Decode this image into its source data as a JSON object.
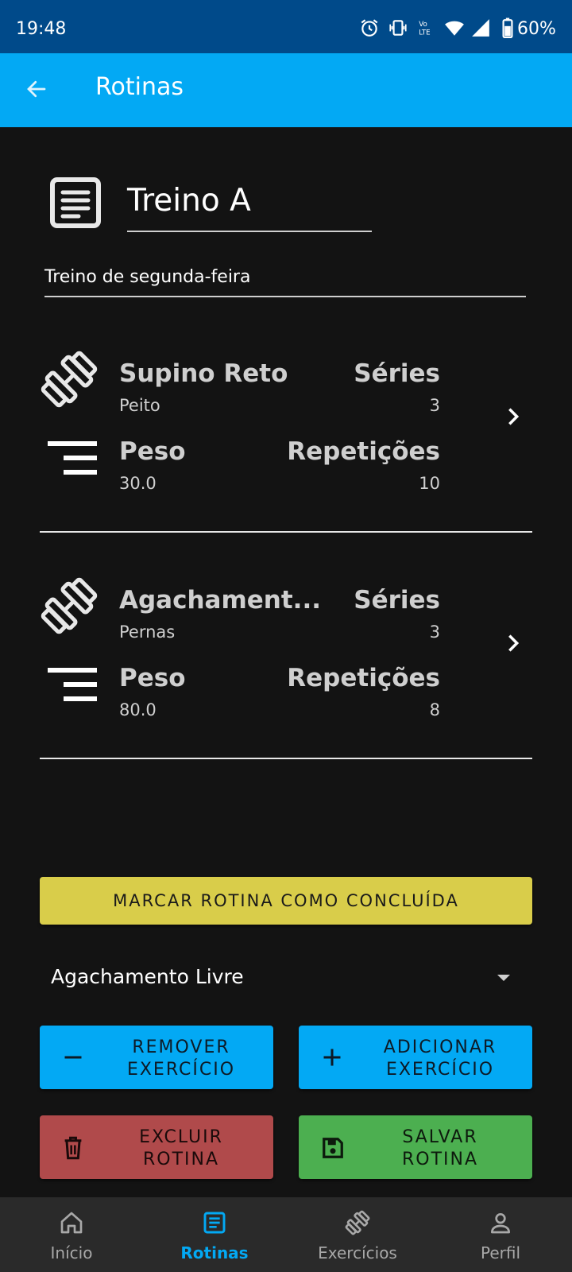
{
  "status_bar": {
    "time": "19:48",
    "battery": "60%",
    "icons": [
      "alarm-icon",
      "vibrate-icon",
      "volte-icon",
      "wifi-icon",
      "signal-icon",
      "battery-icon"
    ]
  },
  "app_bar": {
    "title": "Rotinas",
    "back_icon": "arrow-back-icon"
  },
  "routine": {
    "name": "Treino A",
    "description": "Treino de segunda-feira"
  },
  "labels": {
    "series": "Séries",
    "weight": "Peso",
    "reps": "Repetições"
  },
  "exercises": [
    {
      "name": "Supino Reto",
      "group": "Peito",
      "series": "3",
      "weight": "30.0",
      "reps": "10"
    },
    {
      "name": "Agachament...",
      "group": "Pernas",
      "series": "3",
      "weight": "80.0",
      "reps": "8"
    }
  ],
  "actions": {
    "complete": "MARCAR ROTINA COMO CONCLUÍDA",
    "selected_exercise": "Agachamento Livre",
    "remove_line1": "REMOVER",
    "remove_line2": "EXERCÍCIO",
    "add_line1": "ADICIONAR",
    "add_line2": "EXERCÍCIO",
    "delete_line1": "EXCLUIR",
    "delete_line2": "ROTINA",
    "save_line1": "SALVAR",
    "save_line2": "ROTINA"
  },
  "bottom_nav": [
    {
      "label": "Início",
      "icon": "home-icon",
      "active": false
    },
    {
      "label": "Rotinas",
      "icon": "list-icon",
      "active": true
    },
    {
      "label": "Exercícios",
      "icon": "dumbbell-icon",
      "active": false
    },
    {
      "label": "Perfil",
      "icon": "person-icon",
      "active": false
    }
  ],
  "colors": {
    "status_bar": "#004a8a",
    "app_bar": "#03a9f4",
    "background": "#131313",
    "complete_button": "#d9cd4a",
    "delete_button": "#b04a4b",
    "save_button": "#4caf50",
    "nav_active": "#03a9f4"
  }
}
